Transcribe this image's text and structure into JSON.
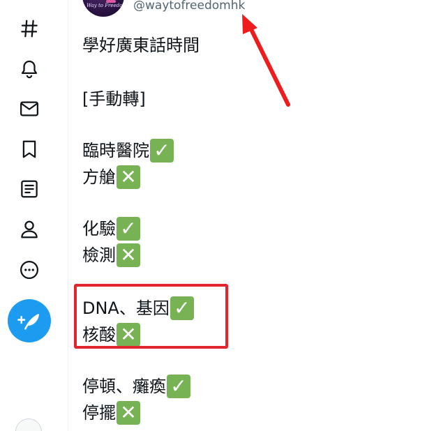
{
  "sidebar": {
    "items": [
      {
        "icon": "hashtag-icon",
        "label": "Explore"
      },
      {
        "icon": "bell-icon",
        "label": "Notifications"
      },
      {
        "icon": "mail-icon",
        "label": "Messages"
      },
      {
        "icon": "bookmark-icon",
        "label": "Bookmarks"
      },
      {
        "icon": "list-icon",
        "label": "Lists"
      },
      {
        "icon": "person-icon",
        "label": "Profile"
      },
      {
        "icon": "more-icon",
        "label": "More"
      }
    ],
    "compose_icon": "feather-plus-icon",
    "accent_color": "#1d9bf0"
  },
  "tweet": {
    "handle": "@waytofreedomhk",
    "avatar_text": "Way to Freedom",
    "lines": [
      {
        "text": "學好廣東話時間",
        "mark": ""
      },
      {
        "text": "[手動轉]",
        "mark": ""
      },
      {
        "text": "臨時醫院",
        "mark": "check"
      },
      {
        "text": "方艙",
        "mark": "cross"
      },
      {
        "text": "化驗",
        "mark": "check"
      },
      {
        "text": "檢測",
        "mark": "cross"
      },
      {
        "text": "DNA、基因",
        "mark": "check"
      },
      {
        "text": "核酸",
        "mark": "cross"
      },
      {
        "text": "停頓、癱瘓",
        "mark": "check"
      },
      {
        "text": "停擺",
        "mark": "cross"
      }
    ],
    "check_glyph": "✓",
    "cross_glyph": "✕",
    "check_color": "#77b255",
    "highlight_color": "#e1262e"
  }
}
